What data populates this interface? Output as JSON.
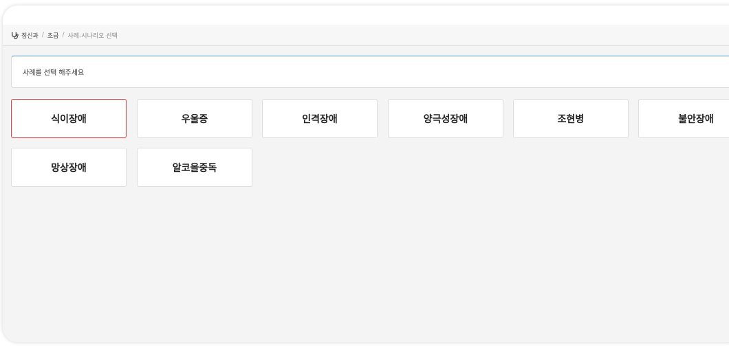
{
  "breadcrumb": {
    "icon": "stethoscope-icon",
    "items": [
      "정신과",
      "초급",
      "사례-시나리오 선택"
    ],
    "separator": "/"
  },
  "prompt": {
    "text": "사례를 선택 해주세요"
  },
  "cases": [
    {
      "label": "식이장애",
      "selected": true
    },
    {
      "label": "우울증",
      "selected": false
    },
    {
      "label": "인격장애",
      "selected": false
    },
    {
      "label": "양극성장애",
      "selected": false
    },
    {
      "label": "조현병",
      "selected": false
    },
    {
      "label": "불안장애",
      "selected": false
    },
    {
      "label": "망상장애",
      "selected": false
    },
    {
      "label": "알코올중독",
      "selected": false
    }
  ],
  "colors": {
    "selected_border": "#e0413e",
    "accent": "#4a90d9"
  }
}
